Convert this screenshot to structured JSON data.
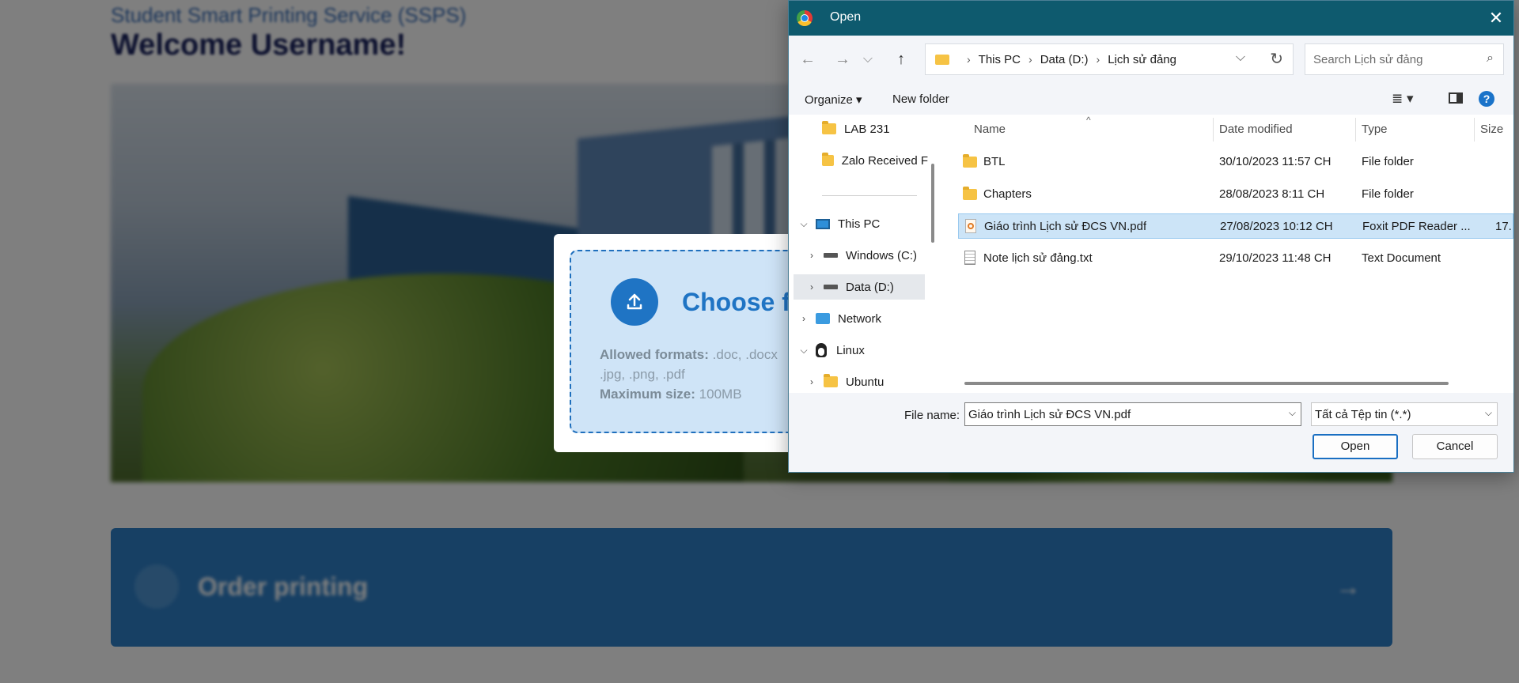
{
  "page": {
    "subtitle": "Student Smart Printing Service (SSPS)",
    "welcome": "Welcome Username!",
    "order_label": "Order printing",
    "order_arrow": "→"
  },
  "upload_modal": {
    "choose_label": "Choose fi",
    "formats_label": "Allowed formats:",
    "formats_value_line1": ".doc, .docx",
    "formats_value_line2": ".jpg, .png, .pdf",
    "max_label": "Maximum size:",
    "max_value": "100MB"
  },
  "dialog": {
    "title": "Open",
    "close": "✕",
    "nav": {
      "back": "←",
      "forward": "→",
      "recent": "⌵",
      "up": "↑"
    },
    "breadcrumb": [
      "This PC",
      "Data (D:)",
      "Lịch sử đảng"
    ],
    "breadcrumb_sep": "›",
    "address_dropdown": "⌵",
    "refresh": "↻",
    "search_placeholder": "Search Lịch sử đảng",
    "search_icon": "⌕",
    "organize_label": "Organize ▾",
    "new_folder_label": "New folder",
    "view_label": "≣ ▾",
    "help_label": "?",
    "nav_items": [
      {
        "label": "LAB 231",
        "icon": "folder-icon"
      },
      {
        "label": "Zalo Received F",
        "icon": "folder-icon"
      },
      {
        "label": "This PC",
        "icon": "computer-icon",
        "chevron": "⌵"
      },
      {
        "label": "Windows (C:)",
        "icon": "drive-icon",
        "chevron": "›"
      },
      {
        "label": "Data (D:)",
        "icon": "drive-icon",
        "chevron": "›",
        "selected": true
      },
      {
        "label": "Network",
        "icon": "network-icon",
        "chevron": "›"
      },
      {
        "label": "Linux",
        "icon": "linux-icon",
        "chevron": "⌵"
      },
      {
        "label": "Ubuntu",
        "icon": "folder-icon",
        "chevron": "›"
      }
    ],
    "columns": {
      "name": "Name",
      "date": "Date modified",
      "type": "Type",
      "size": "Size",
      "sort_caret": "^"
    },
    "files": [
      {
        "name": "BTL",
        "date": "30/10/2023 11:57 CH",
        "type": "File folder",
        "size": "",
        "icon": "folder-icon"
      },
      {
        "name": "Chapters",
        "date": "28/08/2023 8:11 CH",
        "type": "File folder",
        "size": "",
        "icon": "folder-icon"
      },
      {
        "name": "Giáo trình Lịch sử ĐCS VN.pdf",
        "date": "27/08/2023 10:12 CH",
        "type": "Foxit PDF Reader ...",
        "size": "17.",
        "icon": "pdf-icon",
        "selected": true
      },
      {
        "name": "Note lịch sử đảng.txt",
        "date": "29/10/2023 11:48 CH",
        "type": "Text Document",
        "size": "",
        "icon": "text-file-icon"
      }
    ],
    "file_name_label": "File name:",
    "file_name_value": "Giáo trình Lịch sử ĐCS VN.pdf",
    "file_type_value": "Tất cả Tệp tin (*.*)",
    "dropdown_caret": "⌵",
    "open_label": "Open",
    "cancel_label": "Cancel"
  }
}
